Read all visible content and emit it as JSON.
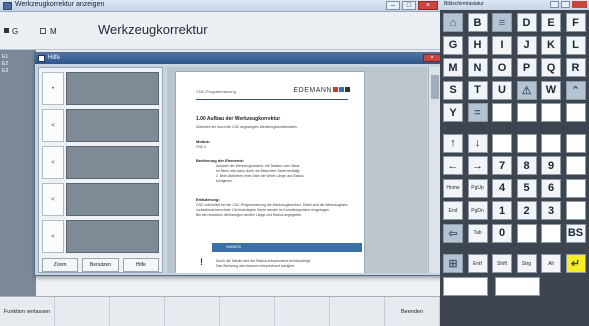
{
  "app": {
    "window_title": "Werkzeugkorrektur anzeigen",
    "header_title": "Werkzeugkorrektur",
    "header_ind_1": "G",
    "header_ind_2": "M",
    "left_strip": [
      "E1",
      "E2",
      "E3"
    ],
    "window_controls": {
      "minimize": "–",
      "maximize": "□",
      "close": "×"
    },
    "softkeys": [
      "Funktion verlassen",
      "",
      "",
      "",
      "",
      "",
      "",
      "Beenden"
    ]
  },
  "dialog": {
    "title": "Hilfe",
    "close_glyph": "×",
    "row_buttons": [
      "•",
      "<",
      "<",
      "<",
      "<",
      "<"
    ],
    "buttons": {
      "close": "Zoom",
      "back": "Benutzen",
      "next": "Hilfe"
    }
  },
  "document": {
    "header_left": "CNC-Programmierung",
    "logo_text": "EDEMANN",
    "colors": {
      "logo_red": "#c43b3b",
      "logo_blue": "#3a6fa8",
      "accent": "#3a6fa8"
    },
    "heading": "1.00 Aufbau der Werkzeugkorrektur",
    "intro": "Übersicht der durch die CNC angezeigten Werkzeugkorrekturdaten.",
    "h_modus": "Modus:",
    "modus_val": "CNC   0",
    "h_bedienung": "Bedienung der Elemente:",
    "bed_lines": [
      "Auswahl der Werkzeugnummer, mit Tastatur oder Maus.",
      "Im Menü wird dann durch die Bildschirm-Taste bestätigt.",
      "2. Beim Aktivieren einer Zeile die Werte Länge und Radius",
      "korrigieren."
    ],
    "h_erlaeuterung": "Erläuterung:",
    "erl_lines": [
      "CNC unterstützt bei der CNC-Programmierung die Werkzeugkorrektur. Dabei wird die Werkzeugbahn",
      "vorbestimmt berechnet. Die hinterlegten Werte werden im Korrekturspeicher eingetragen.",
      "Bei den einzelnen Werkzeugen werden Länge und Radius angegeben."
    ],
    "blue_bar": "HINWEIS",
    "note_lines": [
      "Durch die Tabelle wird der Radius entsprechend berücksichtigt.",
      "Das Werkzeug wird dadurch entsprechend korrigiert."
    ]
  },
  "keyboard": {
    "title": "Bildschirmtastatur",
    "rows": [
      [
        "⌂",
        "B",
        "≡",
        "D",
        "E",
        "F"
      ],
      [
        "G",
        "H",
        "I",
        "J",
        "K",
        "L"
      ],
      [
        "M",
        "N",
        "O",
        "P",
        "Q",
        "R"
      ],
      [
        "S",
        "T",
        "U",
        "⚠",
        "W",
        "⌃"
      ],
      [
        "Y",
        "=",
        "",
        "",
        "",
        ""
      ],
      [
        "↑",
        "↓",
        "",
        "",
        "",
        ""
      ],
      [
        "←",
        "→",
        "7",
        "8",
        "9",
        ""
      ],
      [
        "Home",
        "PgUp",
        "4",
        "5",
        "6",
        ""
      ],
      [
        "End",
        "PgDn",
        "1",
        "2",
        "3",
        ""
      ],
      [
        "⇦",
        "Tab",
        "0",
        "",
        "",
        "BS"
      ],
      [
        "⊞",
        "Entf",
        "Shift",
        "Strg",
        "Alt",
        "↵"
      ]
    ],
    "bottom_keys": [
      "",
      ""
    ],
    "yellow": "#f6ec2a"
  }
}
